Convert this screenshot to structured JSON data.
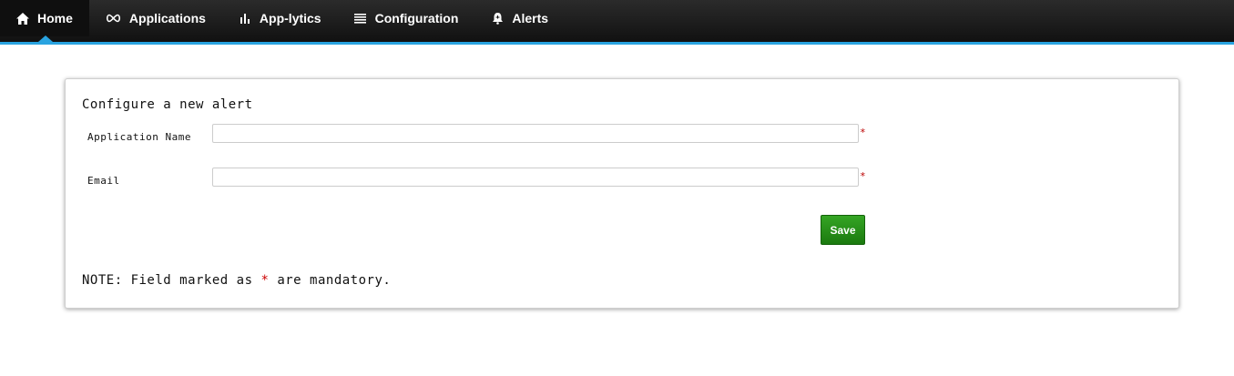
{
  "nav": {
    "items": [
      {
        "label": "Home",
        "icon": "home-icon",
        "active": true
      },
      {
        "label": "Applications",
        "icon": "infinity-icon"
      },
      {
        "label": "App-lytics",
        "icon": "bar-chart-icon"
      },
      {
        "label": "Configuration",
        "icon": "list-icon"
      },
      {
        "label": "Alerts",
        "icon": "alarm-icon"
      }
    ],
    "accent_color": "#29a3e0"
  },
  "form": {
    "title": "Configure a new alert",
    "fields": [
      {
        "label": "Application Name",
        "value": "",
        "required_mark": "*"
      },
      {
        "label": "Email",
        "value": "",
        "required_mark": "*"
      }
    ],
    "save_label": "Save",
    "note_prefix": "NOTE: Field marked as",
    "note_star": "*",
    "note_suffix": "are mandatory."
  }
}
